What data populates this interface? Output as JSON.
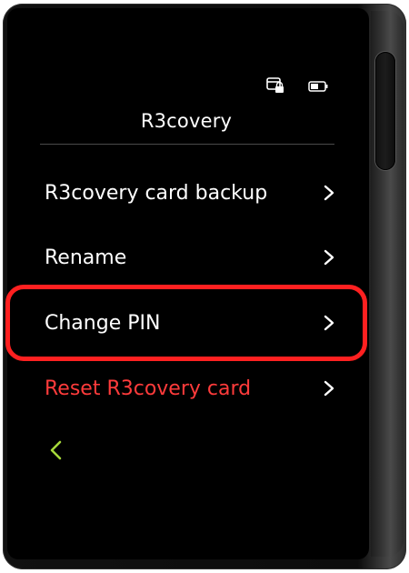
{
  "header": {
    "title": "R3covery",
    "status_icons": [
      "card-lock-icon",
      "battery-icon"
    ]
  },
  "menu": {
    "items": [
      {
        "label": "R3covery card backup",
        "icon": "chevron-right-icon",
        "style": "normal"
      },
      {
        "label": "Rename",
        "icon": "chevron-right-icon",
        "style": "normal"
      },
      {
        "label": "Change PIN",
        "icon": "chevron-right-icon",
        "style": "normal",
        "highlighted": true
      },
      {
        "label": "Reset R3covery card",
        "icon": "chevron-right-icon",
        "style": "danger"
      }
    ]
  },
  "footer": {
    "back_icon": "chevron-left-icon"
  },
  "colors": {
    "background": "#000000",
    "text": "#ffffff",
    "danger": "#ff3b3b",
    "back_accent": "#a6d83a",
    "highlight_border": "#ff2020"
  }
}
